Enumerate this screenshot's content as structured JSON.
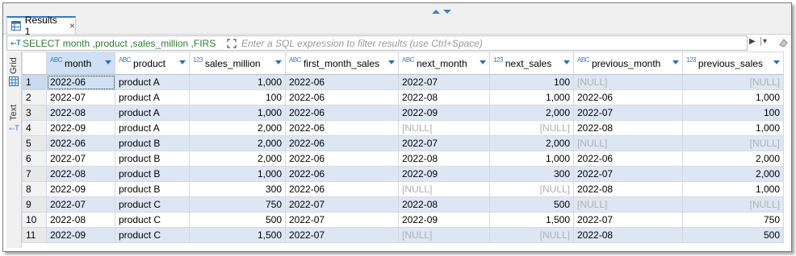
{
  "results_tab": {
    "label": "Results 1",
    "close": "×"
  },
  "filter": {
    "sql": "SELECT month ,product ,sales_million ,FIRST_VALUE",
    "placeholder": "Enter a SQL expression to filter results (use Ctrl+Space)"
  },
  "side_tabs": {
    "grid": "Grid",
    "text": "Text"
  },
  "null_text": "[NULL]",
  "columns": [
    {
      "name": "month",
      "type": "ABC",
      "align": "left"
    },
    {
      "name": "product",
      "type": "ABC",
      "align": "left"
    },
    {
      "name": "sales_million",
      "type": "123",
      "align": "right"
    },
    {
      "name": "first_month_sales",
      "type": "ABC",
      "align": "left"
    },
    {
      "name": "next_month",
      "type": "ABC",
      "align": "left"
    },
    {
      "name": "next_sales",
      "type": "123",
      "align": "right"
    },
    {
      "name": "previous_month",
      "type": "ABC",
      "align": "left"
    },
    {
      "name": "previous_sales",
      "type": "123",
      "align": "right"
    }
  ],
  "rows": [
    [
      "2022-06",
      "product A",
      "1,000",
      "2022-06",
      "2022-07",
      "100",
      null,
      null
    ],
    [
      "2022-07",
      "product A",
      "100",
      "2022-06",
      "2022-08",
      "1,000",
      "2022-06",
      "1,000"
    ],
    [
      "2022-08",
      "product A",
      "1,000",
      "2022-06",
      "2022-09",
      "2,000",
      "2022-07",
      "100"
    ],
    [
      "2022-09",
      "product A",
      "2,000",
      "2022-06",
      null,
      null,
      "2022-08",
      "1,000"
    ],
    [
      "2022-06",
      "product B",
      "2,000",
      "2022-06",
      "2022-07",
      "2,000",
      null,
      null
    ],
    [
      "2022-07",
      "product B",
      "2,000",
      "2022-06",
      "2022-08",
      "1,000",
      "2022-06",
      "2,000"
    ],
    [
      "2022-08",
      "product B",
      "1,000",
      "2022-06",
      "2022-09",
      "300",
      "2022-07",
      "2,000"
    ],
    [
      "2022-09",
      "product B",
      "300",
      "2022-06",
      null,
      null,
      "2022-08",
      "1,000"
    ],
    [
      "2022-07",
      "product C",
      "750",
      "2022-07",
      "2022-08",
      "500",
      null,
      null
    ],
    [
      "2022-08",
      "product C",
      "500",
      "2022-07",
      "2022-09",
      "1,500",
      "2022-07",
      "750"
    ],
    [
      "2022-09",
      "product C",
      "1,500",
      "2022-07",
      null,
      null,
      "2022-08",
      "500"
    ]
  ]
}
